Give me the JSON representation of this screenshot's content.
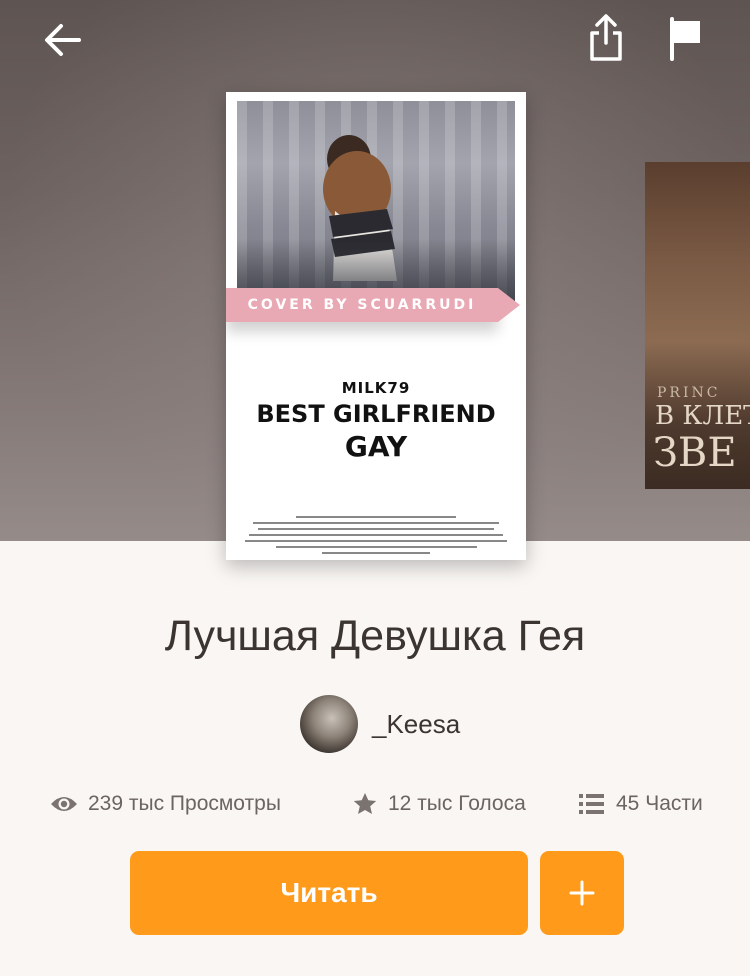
{
  "header": {
    "back_icon": "arrow-left-icon",
    "share_icon": "share-icon",
    "flag_icon": "flag-icon"
  },
  "cover": {
    "ribbon_text": "COVER BY SCUARRUDI",
    "author_text": "MILK79",
    "title_line1": "BEST GIRLFRIEND",
    "title_line2": "GAY"
  },
  "next_cover": {
    "subtitle": "PRINC",
    "title_line1": "В КЛЕТ",
    "title_line2": "ЗВЕ"
  },
  "book": {
    "title": "Лучшая Девушка Гея",
    "author": "_Keesa"
  },
  "stats": {
    "views": "239 тыс Просмотры",
    "votes": "12 тыс Голоса",
    "parts": "45 Части"
  },
  "actions": {
    "read_label": "Читать",
    "add_icon": "plus-icon"
  },
  "colors": {
    "accent": "#ff9a1a",
    "text": "#3b3431",
    "muted": "#6b6461",
    "background": "#f9f6f3"
  }
}
